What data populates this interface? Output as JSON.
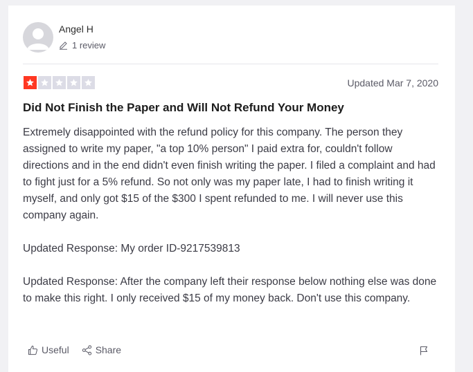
{
  "author": {
    "name": "Angel H",
    "review_count": "1 review"
  },
  "review": {
    "rating": 1,
    "rating_max": 5,
    "star_color": "#ff3722",
    "updated": "Updated Mar 7, 2020",
    "title": "Did Not Finish the Paper and Will Not Refund Your Money",
    "paragraphs": [
      "Extremely disappointed with the refund policy for this company. The person they assigned to write my paper, \"a top 10% person\" I paid extra for, couldn't follow directions and in the end didn't even finish writing the paper. I filed a complaint and had to fight just for a 5% refund. So not only was my paper late, I had to finish writing it myself, and only got $15 of the $300 I spent refunded to me. I will never use this company again.",
      "Updated Response: My order ID-9217539813",
      "Updated Response: After the company left their response below nothing else was done to make this right. I only received $15 of my money back. Don't use this company."
    ]
  },
  "actions": {
    "useful_label": "Useful",
    "share_label": "Share"
  },
  "icons": {
    "avatar": "user-avatar-icon",
    "review_count": "pencil-icon",
    "useful": "thumbs-up-icon",
    "share": "share-icon",
    "flag": "flag-icon"
  }
}
